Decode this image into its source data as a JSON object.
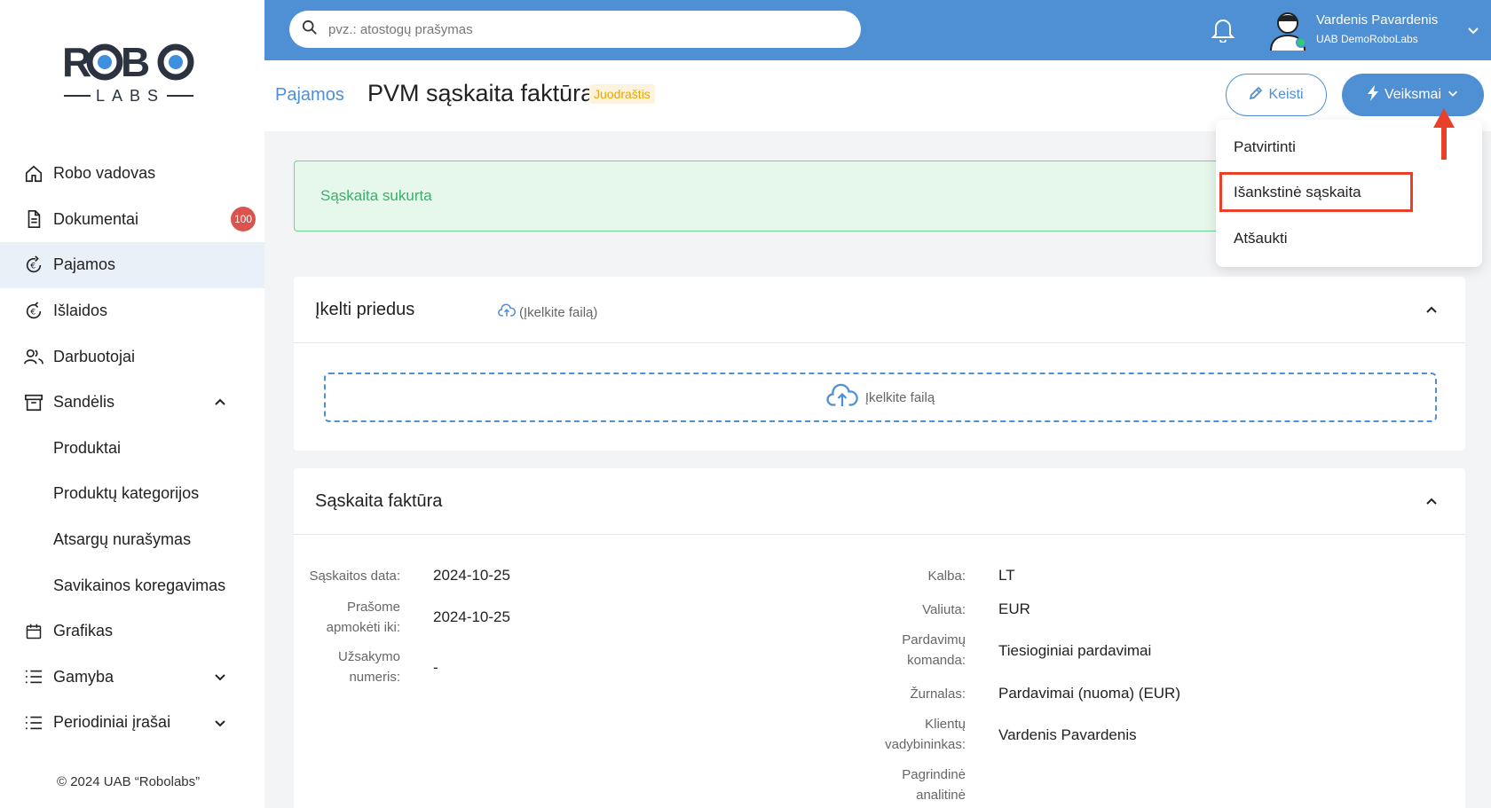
{
  "brand": {
    "logo_top": "ROBO",
    "logo_bottom": "LABS"
  },
  "sidebar": {
    "items": [
      {
        "label": "Robo vadovas",
        "icon": "home-icon"
      },
      {
        "label": "Dokumentai",
        "icon": "document-icon",
        "badge": "100"
      },
      {
        "label": "Pajamos",
        "icon": "income-icon",
        "active": true
      },
      {
        "label": "Išlaidos",
        "icon": "expense-icon"
      },
      {
        "label": "Darbuotojai",
        "icon": "users-icon"
      },
      {
        "label": "Sandėlis",
        "icon": "warehouse-icon",
        "expanded": true
      },
      {
        "label": "Produktai",
        "sub": true
      },
      {
        "label": "Produktų kategorijos",
        "sub": true
      },
      {
        "label": "Atsargų nurašymas",
        "sub": true
      },
      {
        "label": "Savikainos koregavimas",
        "sub": true
      },
      {
        "label": "Grafikas",
        "icon": "calendar-icon"
      },
      {
        "label": "Gamyba",
        "icon": "list-icon",
        "expanded": false
      },
      {
        "label": "Periodiniai įrašai",
        "icon": "list-icon",
        "expanded": false
      }
    ],
    "copyright": "© 2024 UAB “Robolabs”"
  },
  "topbar": {
    "search_placeholder": "pvz.: atostogų prašymas",
    "user_name": "Vardenis Pavardenis",
    "user_company": "UAB DemoRoboLabs",
    "bg_color": "#4f8fd4"
  },
  "header": {
    "breadcrumb": "Pajamos",
    "title": "PVM sąskaita faktūra",
    "status": "Juodraštis",
    "edit_label": "Keisti",
    "actions_label": "Veiksmai"
  },
  "actions_menu": {
    "items": [
      "Patvirtinti",
      "Išankstinė sąskaita",
      "Atšaukti"
    ],
    "highlighted": "Išankstinė sąskaita",
    "highlight_color": "#e8402a"
  },
  "alert": {
    "text": "Sąskaita sukurta"
  },
  "attachments": {
    "title": "Įkelti priedus",
    "upload_link": "(Įkelkite failą)",
    "dropzone_label": "Įkelkite failą"
  },
  "invoice": {
    "title": "Sąskaita faktūra",
    "left": [
      {
        "label": "Sąskaitos data:",
        "value": "2024-10-25"
      },
      {
        "label": "Prašome apmokėti iki:",
        "value": "2024-10-25"
      },
      {
        "label": "Užsakymo numeris:",
        "value": "-"
      }
    ],
    "right": [
      {
        "label": "Kalba:",
        "value": "LT"
      },
      {
        "label": "Valiuta:",
        "value": "EUR"
      },
      {
        "label": "Pardavimų komanda:",
        "value": "Tiesioginiai pardavimai"
      },
      {
        "label": "Žurnalas:",
        "value": "Pardavimai (nuoma) (EUR)"
      },
      {
        "label": "Klientų vadybininkas:",
        "value": "Vardenis Pavardenis"
      },
      {
        "label": "Pagrindinė analitinė",
        "value": ""
      }
    ]
  }
}
